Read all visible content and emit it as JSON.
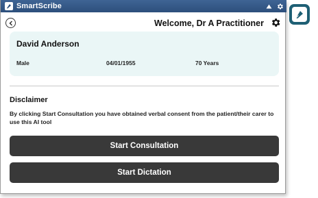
{
  "window": {
    "title": "SmartScribe",
    "app_icon": "pen-nib-icon",
    "controls": [
      "chevron-up-icon",
      "gear-icon"
    ]
  },
  "header": {
    "back_icon": "back-arrow-icon",
    "welcome": "Welcome, Dr A Practitioner",
    "settings_icon": "gear-icon"
  },
  "patient": {
    "name": "David Anderson",
    "gender": "Male",
    "dob": "04/01/1955",
    "age": "70 Years"
  },
  "disclaimer": {
    "title": "Disclaimer",
    "text": "By clicking Start Consultation you have obtained verbal consent from the patient/their carer to use this AI tool"
  },
  "actions": {
    "start_consultation": "Start Consultation",
    "start_dictation": "Start Dictation"
  },
  "side_app": {
    "icon": "pen-nib-icon"
  },
  "colors": {
    "titlebar": "#2d4f7c",
    "card_bg": "#eaf6f6",
    "button_bg": "#393939",
    "side_tile": "#1e5f74"
  }
}
